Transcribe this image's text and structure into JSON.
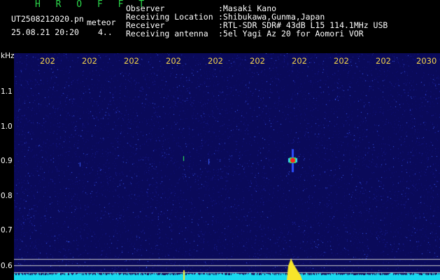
{
  "header": {
    "brand": "H R O F F T",
    "filename": "UT2508212020.pn",
    "tag": "meteor",
    "datetime": "25.08.21 20:20",
    "code": "4..",
    "fields": [
      {
        "label": "Observer",
        "value": ":Masaki Kano"
      },
      {
        "label": "Receiving Location",
        "value": ":Shibukawa,Gunma,Japan"
      },
      {
        "label": "Receiver",
        "value": ":RTL-SDR SDR# 43dB L15 114.1MHz USB"
      },
      {
        "label": "Receiving antenna",
        "value": ":5el Yagi Az 20 for Aomori VOR"
      }
    ]
  },
  "axis": {
    "y_unit": "kHz",
    "y_ticks": [
      "1.1",
      "1.0",
      "0.9",
      "0.8",
      "0.7",
      "0.6"
    ],
    "x_ticks": [
      "202",
      "202",
      "202",
      "202",
      "202",
      "202",
      "202",
      "202",
      "202",
      "2030"
    ]
  },
  "colors": {
    "background": "#0a0a5a",
    "brand": "#2bd64a",
    "x_tick": "#f5d34a",
    "meteor": "#ff2020",
    "baseline": "#19d9ee"
  }
}
